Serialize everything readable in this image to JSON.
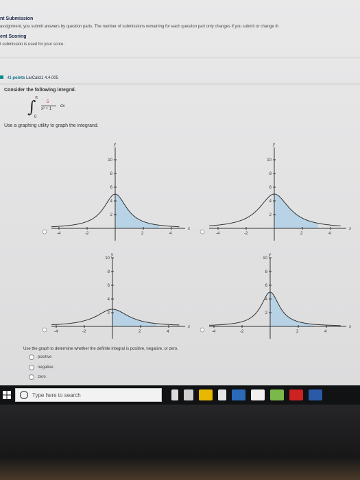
{
  "submission": {
    "title": "nt Submission",
    "text": "assignment, you submit answers by question parts. The number of submissions remaining for each question part only changes if you submit or change th"
  },
  "scoring": {
    "title": "ent Scoring",
    "text": "t submission is used for your score."
  },
  "question": {
    "header_points": "-/1 points",
    "header_source": "LarCalcl1 4.4.005",
    "prompt": "Consider the following integral.",
    "integral": {
      "upper": "π",
      "lower": "0",
      "numerator": "5",
      "denominator": "x² + 1",
      "dx": "dx"
    },
    "graph_instruction": "Use a graphing utility to graph the integrand.",
    "sign_question": "Use the graph to determine whether the definite integral is positive, negative, or zero.",
    "choices": [
      "positive",
      "negative",
      "zero"
    ]
  },
  "graphs": {
    "x_axis_label": "x",
    "y_axis_label": "y",
    "x_ticks": [
      "-4",
      "-2",
      "2",
      "4"
    ],
    "y_ticks": [
      "2",
      "4",
      "6",
      "8",
      "10"
    ]
  },
  "taskbar": {
    "search_placeholder": "Type here to search"
  },
  "colors": {
    "shaded_area": "#a9cde6",
    "points_link": "#0a6d8c",
    "numerator": "#cc3333",
    "taskbar": "#101214"
  }
}
